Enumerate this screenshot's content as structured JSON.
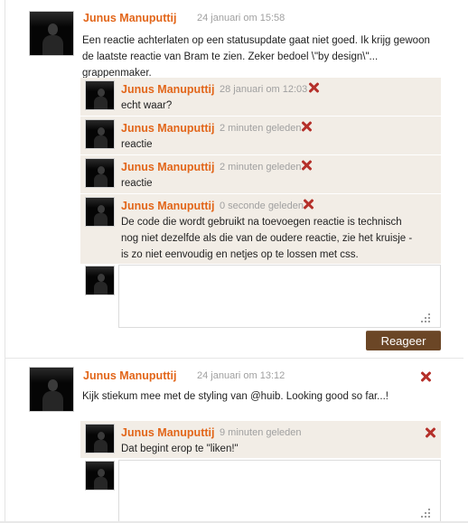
{
  "posts": [
    {
      "author": "Junus Manuputtij",
      "timestamp": "24 januari om 15:58",
      "text": "Een reactie achterlaten op een statusupdate gaat niet goed. Ik krijg gewoon de laatste reactie van Bram te zien. Zeker bedoel \\\"by design\\\"... grappenmaker.",
      "replies": [
        {
          "author": "Junus Manuputtij",
          "timestamp": "28 januari om 12:03",
          "text": "echt waar?"
        },
        {
          "author": "Junus Manuputtij",
          "timestamp": "2 minuten geleden",
          "text": "reactie"
        },
        {
          "author": "Junus Manuputtij",
          "timestamp": "2 minuten geleden",
          "text": "reactie"
        },
        {
          "author": "Junus Manuputtij",
          "timestamp": "0 seconde geleden",
          "text": "De code die wordt gebruikt na toevoegen reactie is technisch nog niet dezelfde als die van de oudere reactie, zie het kruisje - is zo niet eenvoudig en netjes op te lossen met css."
        }
      ],
      "reply_input_value": "",
      "submit_label": "Reageer"
    },
    {
      "author": "Junus Manuputtij",
      "timestamp": "24 januari om 13:12",
      "text": "Kijk stiekum mee met de styling van @huib. Looking good so far...!",
      "replies": [
        {
          "author": "Junus Manuputtij",
          "timestamp": "9 minuten geleden",
          "text": "Dat begint erop te \"liken!\""
        }
      ],
      "reply_input_value": ""
    }
  ],
  "icons": {
    "delete": "close-x-icon",
    "resize": "resize-grip-icon"
  },
  "colors": {
    "author": "#e2661a",
    "delete": "#b5302a",
    "reply_bg": "#f2ede6",
    "button": "#6b4626"
  }
}
